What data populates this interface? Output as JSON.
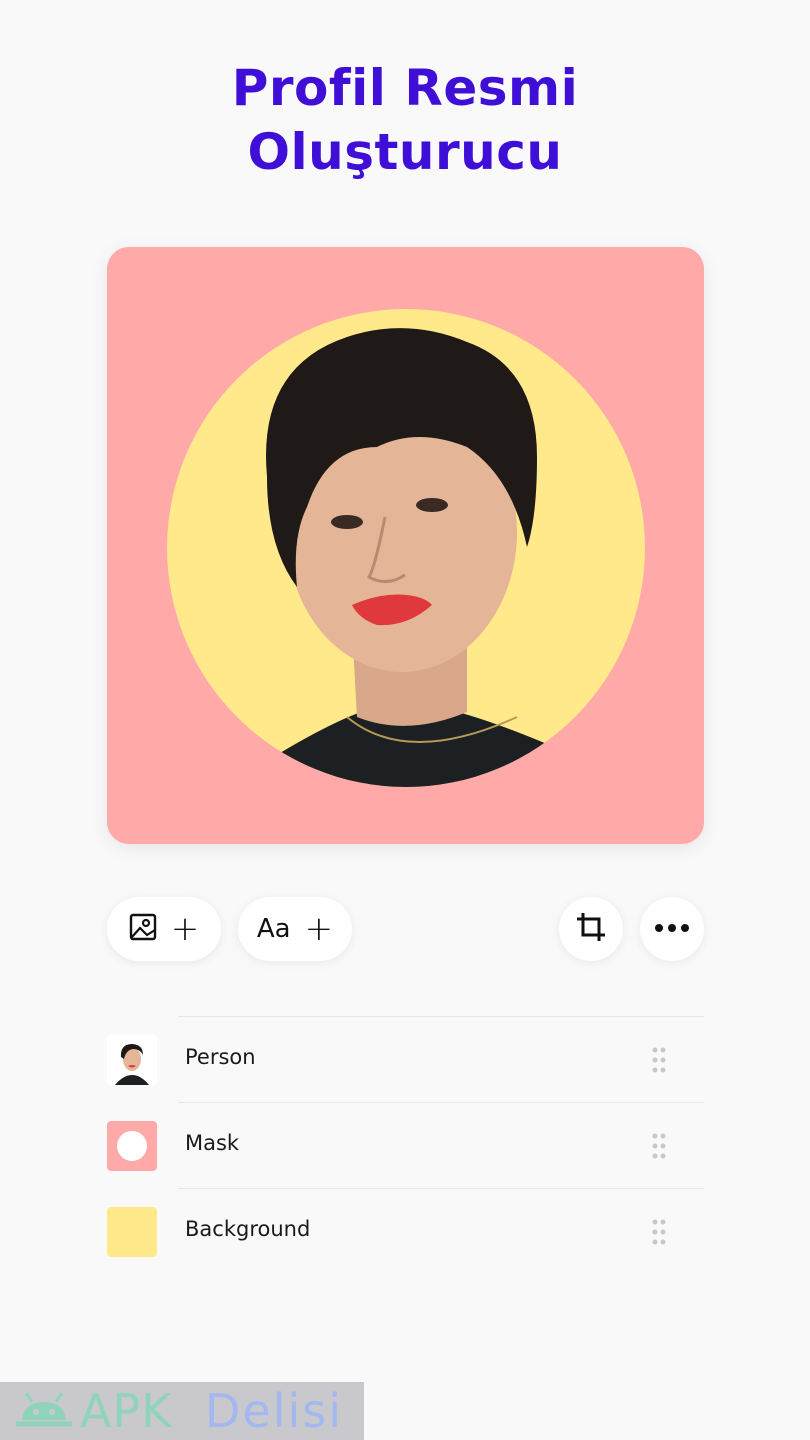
{
  "header": {
    "title_line1": "Profil Resmi",
    "title_line2": "Oluşturucu"
  },
  "canvas": {
    "background_color": "#ffa9a9",
    "circle_color": "#ffe98a",
    "subject": "person-portrait"
  },
  "toolbar": {
    "add_image_icon": "image-icon",
    "add_text_label": "Aa",
    "crop_icon": "crop-icon",
    "more_icon": "more-horizontal-icon"
  },
  "layers": [
    {
      "label": "Person",
      "thumb": "person"
    },
    {
      "label": "Mask",
      "thumb": "mask"
    },
    {
      "label": "Background",
      "thumb": "background"
    }
  ],
  "watermark": {
    "part1": "APK",
    "part2": "Delisi"
  },
  "colors": {
    "accent": "#3f0fd8",
    "pink": "#ffa9a9",
    "yellow": "#ffe98a"
  }
}
